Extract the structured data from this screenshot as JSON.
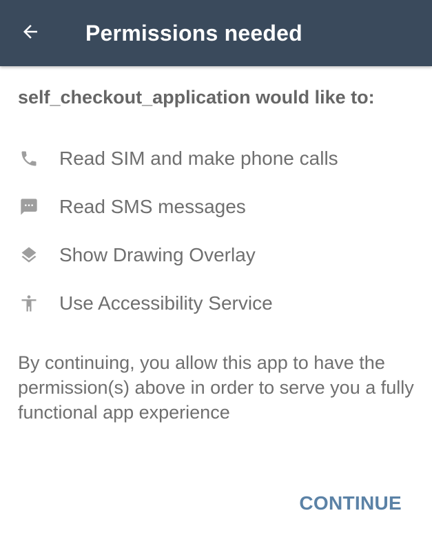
{
  "header": {
    "title": "Permissions needed",
    "back_icon": "arrow-left-icon",
    "background_color": "#3a4a5c"
  },
  "intro": {
    "text": "self_checkout_application would like to:"
  },
  "permissions": [
    {
      "icon": "phone-icon",
      "label": "Read SIM and make phone calls"
    },
    {
      "icon": "sms-icon",
      "label": "Read SMS messages"
    },
    {
      "icon": "layers-icon",
      "label": "Show Drawing Overlay"
    },
    {
      "icon": "accessibility-icon",
      "label": "Use Accessibility Service"
    }
  ],
  "disclaimer": {
    "text": "By continuing, you allow this app to have the permission(s) above in order to serve you a fully functional app experience"
  },
  "actions": {
    "continue_label": "CONTINUE",
    "accent_color": "#5b82a6"
  }
}
